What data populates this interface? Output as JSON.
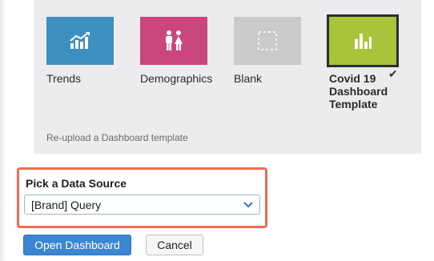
{
  "templates": [
    {
      "label": "Trends",
      "icon": "trend-chart-icon"
    },
    {
      "label": "Demographics",
      "icon": "people-icon"
    },
    {
      "label": "Blank",
      "icon": "blank-dashed-icon"
    },
    {
      "label": "Covid 19 Dashboard Template",
      "icon": "bar-chart-icon",
      "selected": true
    }
  ],
  "reupload_text": "Re-upload a Dashboard template",
  "data_source": {
    "title": "Pick a Data Source",
    "selected_value": "[Brand] Query"
  },
  "buttons": {
    "open": "Open Dashboard",
    "cancel": "Cancel"
  },
  "colors": {
    "trends": "#3d8fbf",
    "demographics": "#c9467f",
    "blank": "#c9cacc",
    "covid": "#a7c43a",
    "highlight_border": "#ef6b52",
    "primary_button": "#3a86d2"
  }
}
